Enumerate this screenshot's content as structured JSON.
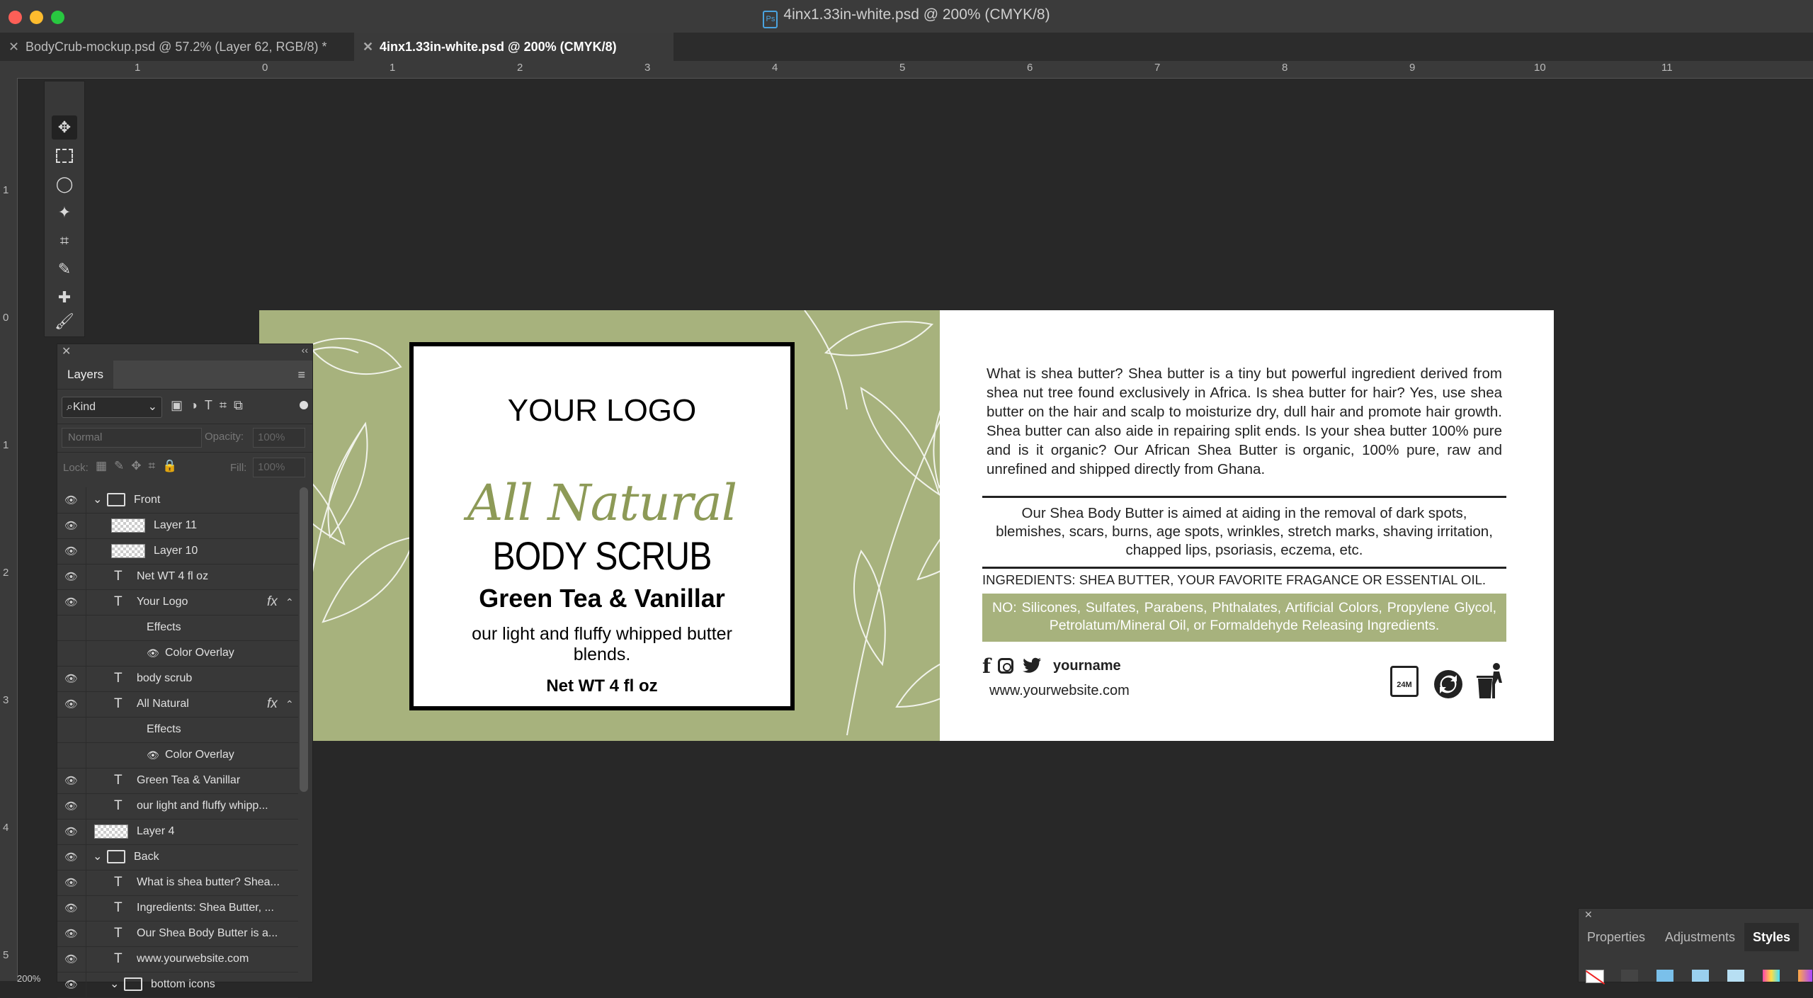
{
  "window": {
    "title": "4inx1.33in-white.psd @ 200% (CMYK/8)"
  },
  "tabs": [
    {
      "label": "BodyCrub-mockup.psd @ 57.2% (Layer 62, RGB/8) *"
    },
    {
      "label": "4inx1.33in-white.psd @ 200% (CMYK/8)"
    }
  ],
  "ruler": {
    "h": [
      "1",
      "0",
      "1",
      "2",
      "3",
      "4",
      "5",
      "6",
      "7",
      "8",
      "9",
      "10",
      "11"
    ],
    "v": [
      "1",
      "0",
      "1",
      "2",
      "3",
      "4",
      "5"
    ]
  },
  "zoom": "200%",
  "layers_panel": {
    "title": "Layers",
    "filter_kind": "Kind",
    "blend_mode": "Normal",
    "opacity_label": "Opacity:",
    "opacity_value": "100%",
    "lock_label": "Lock:",
    "fill_label": "Fill:",
    "fill_value": "100%",
    "rows": [
      {
        "type": "group",
        "label": "Front"
      },
      {
        "type": "pixel",
        "label": "Layer 11"
      },
      {
        "type": "pixel",
        "label": "Layer 10"
      },
      {
        "type": "text",
        "label": "Net WT 4 fl oz"
      },
      {
        "type": "text",
        "label": "Your Logo",
        "fx": "fx"
      },
      {
        "type": "effects",
        "label": "Effects"
      },
      {
        "type": "effect",
        "label": "Color Overlay"
      },
      {
        "type": "text",
        "label": "body scrub"
      },
      {
        "type": "text",
        "label": "All Natural",
        "fx": "fx"
      },
      {
        "type": "effects",
        "label": "Effects"
      },
      {
        "type": "effect",
        "label": "Color Overlay"
      },
      {
        "type": "text",
        "label": "Green Tea & Vanillar"
      },
      {
        "type": "text",
        "label": "our light and fluffy whipp..."
      },
      {
        "type": "pixel",
        "label": "Layer 4"
      },
      {
        "type": "group",
        "label": "Back"
      },
      {
        "type": "text",
        "label": "What is shea butter? Shea..."
      },
      {
        "type": "text",
        "label": "Ingredients: Shea Butter, ..."
      },
      {
        "type": "text",
        "label": "Our Shea Body Butter is a..."
      },
      {
        "type": "text",
        "label": "www.yourwebsite.com"
      },
      {
        "type": "subgroup",
        "label": "bottom icons"
      }
    ]
  },
  "label_front": {
    "logo": "YOUR LOGO",
    "script": "All Natural",
    "product": "BODY SCRUB",
    "flavor": "Green Tea & Vanillar",
    "desc": "our light and fluffy whipped butter blends.",
    "net": "Net WT 4 fl oz"
  },
  "label_back": {
    "para1": "What is shea butter? Shea butter is a tiny but powerful ingredient derived from shea nut tree found exclusively in Africa. Is shea butter for hair? Yes, use shea butter on the hair and scalp to moisturize dry, dull hair and promote hair growth. Shea butter can also aide in repairing split ends. Is your shea butter 100% pure and is it organic? Our African Shea Butter is organic, 100% pure, raw and unrefined and shipped directly from Ghana.",
    "para2": "Our Shea Body Butter is aimed at aiding in the removal of dark spots, blemishes, scars, burns, age spots, wrinkles, stretch marks, shaving irritation, chapped lips, psoriasis, eczema, etc.",
    "ingredients": "INGREDIENTS: SHEA BUTTER, YOUR FAVORITE FRAGANCE OR ESSENTIAL OIL.",
    "no_list": "NO: Silicones, Sulfates, Parabens, Phthalates, Artificial Colors, Propylene Glycol, Petrolatum/Mineral Oil, or Formaldehyde Releasing Ingredients.",
    "username": "yourname",
    "website": "www.yourwebsite.com",
    "jar_label": "24M"
  },
  "right_panel": {
    "tabs": [
      "Properties",
      "Adjustments",
      "Styles"
    ]
  },
  "colors": {
    "sage": "#a7b27d",
    "ps_bg": "#282828"
  }
}
